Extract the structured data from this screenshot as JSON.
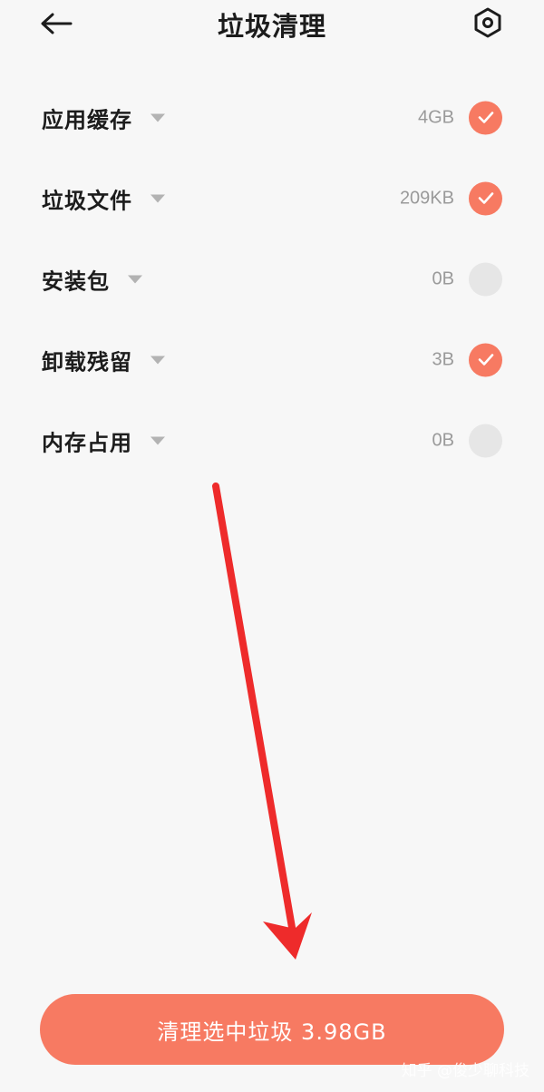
{
  "header": {
    "title": "垃圾清理",
    "back_icon": "arrow-left-icon",
    "settings_icon": "settings-hexagon-icon"
  },
  "items": [
    {
      "label": "应用缓存",
      "size": "4GB",
      "checked": true
    },
    {
      "label": "垃圾文件",
      "size": "209KB",
      "checked": true
    },
    {
      "label": "安装包",
      "size": "0B",
      "checked": false
    },
    {
      "label": "卸载残留",
      "size": "3B",
      "checked": true
    },
    {
      "label": "内存占用",
      "size": "0B",
      "checked": false
    }
  ],
  "action": {
    "clean_label": "清理选中垃圾 3.98GB"
  },
  "watermark": "知乎 @俊少聊科技",
  "colors": {
    "accent": "#f77a62",
    "annotation": "#ee2b2b",
    "background": "#f7f7f7"
  }
}
